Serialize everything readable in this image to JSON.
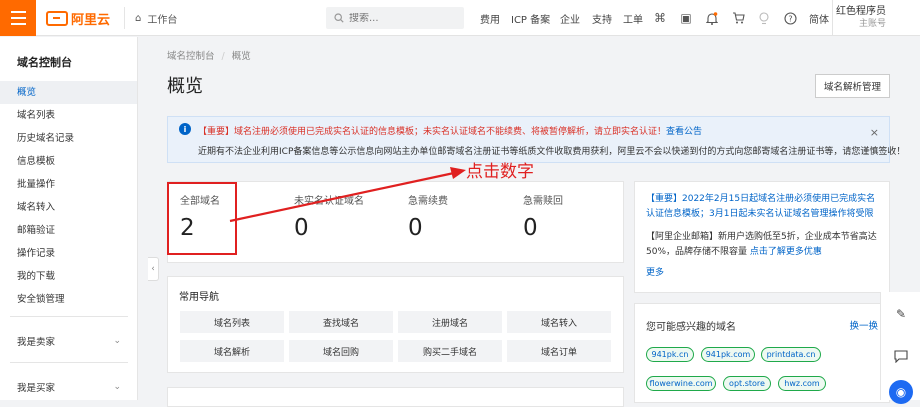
{
  "header": {
    "logo_text": "阿里云",
    "workbench": "工作台",
    "search_placeholder": "搜索...",
    "nav": [
      "费用",
      "ICP 备案",
      "企业",
      "支持",
      "工单"
    ],
    "icons": [
      "terminal-icon",
      "monitor-icon",
      "bell-icon",
      "cart-icon",
      "lightbulb-icon",
      "help-icon"
    ],
    "lang": "简体",
    "user_name": "红色程序员",
    "user_role": "主账号"
  },
  "sidebar": {
    "title": "域名控制台",
    "items": [
      "概览",
      "域名列表",
      "历史域名记录",
      "信息模板",
      "批量操作",
      "域名转入",
      "邮箱验证",
      "操作记录",
      "我的下载",
      "安全锁管理"
    ],
    "group_seller": "我是卖家",
    "group_buyer": "我是买家"
  },
  "page": {
    "breadcrumb_1": "域名控制台",
    "breadcrumb_sep": "/",
    "breadcrumb_2": "概览",
    "title": "概览",
    "dns_button": "域名解析管理"
  },
  "notice": {
    "line1_prefix": "【重要】域名注册必须使用已完成实名认证的信息模板；未实名认证域名不能续费、将被暂停解析，请立即实名认证！",
    "line1_link": "查看公告",
    "line2": "近期有不法企业利用ICP备案信息等公示信息向网站主办单位邮寄域名注册证书等纸质文件收取费用获利，阿里云不会以快递到付的方式向您邮寄域名注册证书等，请您谨慎签收！"
  },
  "stats": [
    {
      "label": "全部域名",
      "value": "2"
    },
    {
      "label": "未实名认证域名",
      "value": "0"
    },
    {
      "label": "急需续费",
      "value": "0"
    },
    {
      "label": "急需赎回",
      "value": "0"
    }
  ],
  "annotation": {
    "text": "点击数字",
    "color": "#e02020"
  },
  "quick_nav": {
    "title": "常用导航",
    "buttons": [
      "域名列表",
      "查找域名",
      "注册域名",
      "域名转入",
      "域名解析",
      "域名回购",
      "购买二手域名",
      "域名订单"
    ]
  },
  "announcements": {
    "item1": "【重要】2022年2月15日起域名注册必须使用已完成实名认证信息模板；3月1日起未实名认证域名管理操作将受限",
    "item2_prefix": "【阿里企业邮箱】新用户选购低至5折，企业成本节省高达50%，品牌存储不限容量",
    "item2_link": "点击了解更多优惠",
    "more": "更多"
  },
  "interest": {
    "title": "您可能感兴趣的域名",
    "refresh": "换一换",
    "tags": [
      "941pk.cn",
      "941pk.com",
      "printdata.cn",
      "flowerwine.com",
      "opt.store",
      "hwz.com"
    ]
  },
  "colors": {
    "brand": "#ff6a00",
    "link": "#0064c8",
    "danger": "#e02020",
    "tag_border": "#1fa94a"
  }
}
